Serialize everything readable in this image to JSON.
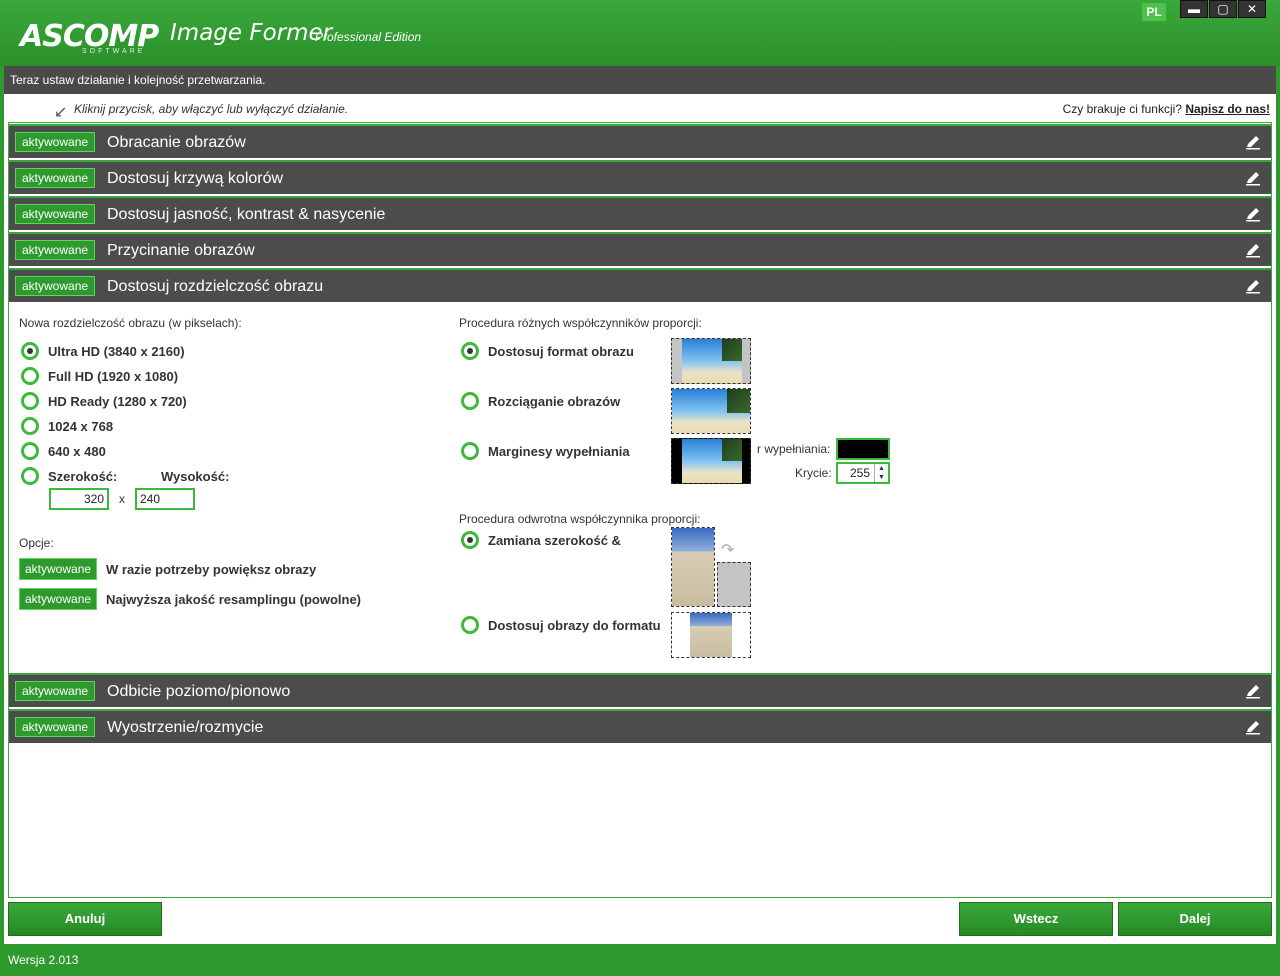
{
  "titlebar": {
    "logo": "ASCOMP",
    "logo_sub": "SOFTWARE",
    "title": "Image Former",
    "edition": "Professional Edition",
    "lang": "PL",
    "minimize": "▬",
    "maximize": "▢",
    "close": "✕"
  },
  "instruction": "Teraz ustaw działanie i kolejność przetwarzania.",
  "hint": "Kliknij przycisk, aby włączyć lub wyłączyć działanie.",
  "missing": {
    "text": "Czy brakuje ci funkcji?",
    "link": "Napisz do nas!"
  },
  "sections_top": [
    {
      "badge": "aktywowane",
      "title": "Obracanie obrazów"
    },
    {
      "badge": "aktywowane",
      "title": "Dostosuj krzywą kolorów"
    },
    {
      "badge": "aktywowane",
      "title": "Dostosuj jasność, kontrast & nasycenie"
    },
    {
      "badge": "aktywowane",
      "title": "Przycinanie obrazów"
    },
    {
      "badge": "aktywowane",
      "title": "Dostosuj rozdzielczość obrazu"
    }
  ],
  "sections_bottom": [
    {
      "badge": "aktywowane",
      "title": "Odbicie poziomo/pionowo"
    },
    {
      "badge": "aktywowane",
      "title": "Wyostrzenie/rozmycie"
    }
  ],
  "resolution": {
    "label": "Nowa rozdzielczość obrazu (w pikselach):",
    "options": [
      "Ultra HD (3840 x 2160)",
      "Full HD (1920 x 1080)",
      "HD Ready (1280 x 720)",
      "1024 x 768",
      "640 x 480"
    ],
    "selected": 0,
    "width_label": "Szerokość:",
    "height_label": "Wysokość:",
    "width_value": "320",
    "height_value": "240",
    "x": "x"
  },
  "options": {
    "label": "Opcje:",
    "items": [
      {
        "badge": "aktywowane",
        "text": "W razie potrzeby powiększ obrazy"
      },
      {
        "badge": "aktywowane",
        "text": "Najwyższa jakość resamplingu (powolne)"
      }
    ]
  },
  "aspect": {
    "label": "Procedura różnych współczynników proporcji:",
    "options": [
      "Dostosuj format obrazu",
      "Rozciąganie obrazów",
      "Marginesy wypełniania"
    ],
    "selected": 0,
    "fill_color_label": "r wypełniania:",
    "fill_color": "#000000",
    "opacity_label": "Krycie:",
    "opacity_value": "255"
  },
  "inverse": {
    "label": "Procedura odwrotna współczynnika proporcji:",
    "options": [
      "Zamiana szerokość &",
      "Dostosuj obrazy do formatu"
    ],
    "selected": 0
  },
  "footer": {
    "cancel": "Anuluj",
    "back": "Wstecz",
    "next": "Dalej",
    "version": "Wersja 2.013"
  },
  "colors": {
    "accent": "#2e9a2e",
    "dark": "#4c4c4c"
  }
}
